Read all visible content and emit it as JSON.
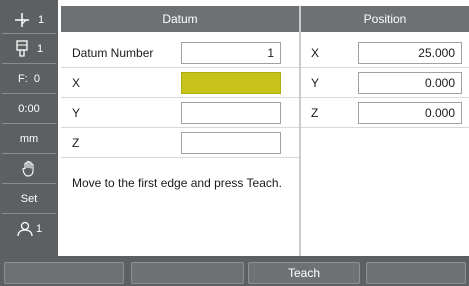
{
  "status_bar": {
    "axis_mode_value": "1",
    "tool_value": "1",
    "feed_rate": "F:  0",
    "timer": "0:00",
    "units": "mm",
    "enable_label": "Set",
    "operator_value": "1"
  },
  "datum_panel": {
    "title": "Datum",
    "datum_number_label": "Datum Number",
    "datum_number_value": "1",
    "axis_x_label": "X",
    "axis_x_value": "",
    "axis_y_label": "Y",
    "axis_y_value": "",
    "axis_z_label": "Z",
    "axis_z_value": "",
    "message": "Move to the first edge and press Teach."
  },
  "position_panel": {
    "title": "Position",
    "x_label": "X",
    "x_value": "25.000",
    "y_label": "Y",
    "y_value": "0.000",
    "z_label": "Z",
    "z_value": "0.000"
  },
  "softkeys": [
    "",
    "",
    "Teach",
    ""
  ],
  "colors": {
    "active_field": "#c8c31a",
    "chrome": "#5d6062",
    "header": "#6e7173"
  }
}
